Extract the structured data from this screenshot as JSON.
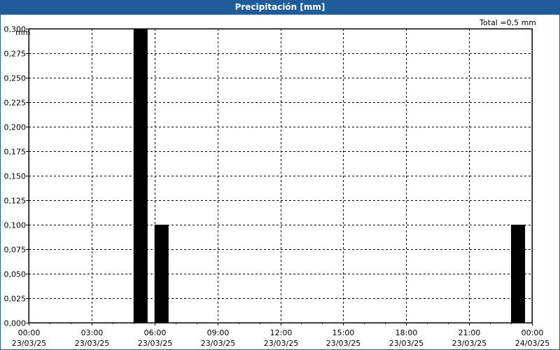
{
  "window": {
    "title": "Precipitación [mm]"
  },
  "summary": {
    "total_label": "Total =0,5 mm"
  },
  "colors": {
    "titlebar": "#1f5c99",
    "bar": "#000000",
    "grid": "#000000"
  },
  "chart_data": {
    "type": "bar",
    "title": "Precipitación [mm]",
    "ylabel": "mm",
    "xlabel": "",
    "ylim": [
      0,
      0.3
    ],
    "y_ticks": [
      "0,000",
      "0,025",
      "0,050",
      "0,075",
      "0,100",
      "0,125",
      "0,150",
      "0,175",
      "0,200",
      "0,225",
      "0,250",
      "0,275",
      "0,300"
    ],
    "x_range_hours": [
      0,
      24
    ],
    "x_ticks": [
      {
        "hour": 0,
        "time": "00:00",
        "date": "23/03/25"
      },
      {
        "hour": 3,
        "time": "03:00",
        "date": "23/03/25"
      },
      {
        "hour": 6,
        "time": "06:00",
        "date": "23/03/25"
      },
      {
        "hour": 9,
        "time": "09:00",
        "date": "23/03/25"
      },
      {
        "hour": 12,
        "time": "12:00",
        "date": "23/03/25"
      },
      {
        "hour": 15,
        "time": "15:00",
        "date": "23/03/25"
      },
      {
        "hour": 18,
        "time": "18:00",
        "date": "23/03/25"
      },
      {
        "hour": 21,
        "time": "21:00",
        "date": "23/03/25"
      },
      {
        "hour": 24,
        "time": "00:00",
        "date": "24/03/25"
      }
    ],
    "bars": [
      {
        "start_hour": 5.0,
        "end_hour": 5.67,
        "value": 0.3
      },
      {
        "start_hour": 6.0,
        "end_hour": 6.67,
        "value": 0.1
      },
      {
        "start_hour": 23.0,
        "end_hour": 23.67,
        "value": 0.1
      }
    ],
    "grid": true
  }
}
